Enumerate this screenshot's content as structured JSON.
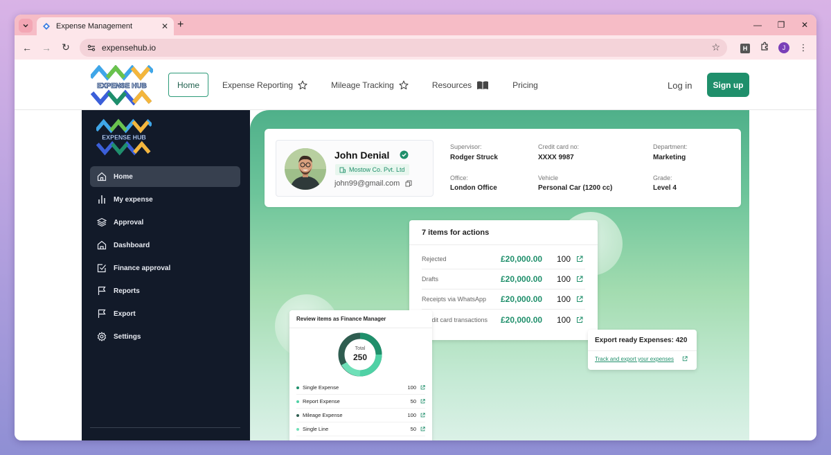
{
  "browser": {
    "tab_title": "Expense Management",
    "url": "expensehub.io",
    "profile_initial": "J",
    "extension_letter": "H"
  },
  "nav": {
    "logo_text": "EXPENSE HUB",
    "items": [
      {
        "label": "Home",
        "icon": null
      },
      {
        "label": "Expense Reporting",
        "icon": "star-icon"
      },
      {
        "label": "Mileage Tracking",
        "icon": "star-icon"
      },
      {
        "label": "Resources",
        "icon": "book-icon"
      },
      {
        "label": "Pricing",
        "icon": null
      }
    ],
    "login": "Log in",
    "signup": "Sign up"
  },
  "sidebar": {
    "logo_text": "EXPENSE HUB",
    "items": [
      {
        "label": "Home",
        "icon": "home-icon",
        "active": true
      },
      {
        "label": "My expense",
        "icon": "bar-chart-icon",
        "active": false
      },
      {
        "label": "Approval",
        "icon": "layers-icon",
        "active": false
      },
      {
        "label": "Dashboard",
        "icon": "building-icon",
        "active": false
      },
      {
        "label": "Finance approval",
        "icon": "checkbox-icon",
        "active": false
      },
      {
        "label": "Reports",
        "icon": "flag-icon",
        "active": false
      },
      {
        "label": "Export",
        "icon": "flag-icon",
        "active": false
      },
      {
        "label": "Settings",
        "icon": "gear-icon",
        "active": false
      }
    ]
  },
  "profile": {
    "name": "John Denial",
    "company": "Mostow Co. Pvt. Ltd",
    "email": "john99@gmail.com",
    "fields": {
      "supervisor_label": "Supervisor:",
      "supervisor": "Rodger Struck",
      "card_label": "Credit card no:",
      "card": "XXXX 9987",
      "department_label": "Department:",
      "department": "Marketing",
      "office_label": "Office:",
      "office": "London Office",
      "vehicle_label": "Vehicle",
      "vehicle": "Personal Car (1200 cc)",
      "grade_label": "Grade:",
      "grade": "Level 4"
    }
  },
  "actions": {
    "title": "7 items for actions",
    "rows": [
      {
        "label": "Rejected",
        "amount": "£20,000.00",
        "count": "100"
      },
      {
        "label": "Drafts",
        "amount": "£20,000.00",
        "count": "100"
      },
      {
        "label": "Receipts via WhatsApp",
        "amount": "£20,000.00",
        "count": "100"
      },
      {
        "label": "Credit card transactions",
        "amount": "£20,000.00",
        "count": "100"
      }
    ]
  },
  "export": {
    "title": "Export ready Expenses: 420",
    "link": "Track and export your expenses"
  },
  "review": {
    "title": "Review items as Finance Manager",
    "total_label": "Total",
    "total": "250",
    "rows": [
      {
        "label": "Single Expense",
        "value": "100",
        "color": "#1f8f6b"
      },
      {
        "label": "Report Expense",
        "value": "50",
        "color": "#4fd1a5"
      },
      {
        "label": "Mileage Expense",
        "value": "100",
        "color": "#2f5d50"
      },
      {
        "label": "Single Line",
        "value": "50",
        "color": "#6fe0b8"
      }
    ]
  },
  "colors": {
    "accent": "#1f8f6b",
    "sidebar_bg": "#121a29",
    "tab_bar": "#f6bcc6"
  }
}
